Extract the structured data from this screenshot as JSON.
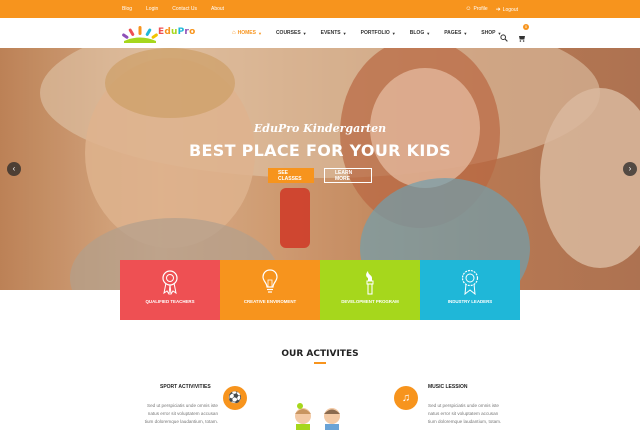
{
  "topbar": {
    "links": [
      "Blog",
      "Login",
      "Contact Us",
      "About"
    ],
    "profile": "Profile",
    "logout": "Logout"
  },
  "logo": {
    "text": "EduPro"
  },
  "nav": {
    "items": [
      "HOMES",
      "COURSES",
      "EVENTS",
      "PORTFOLIO",
      "BLOG",
      "PAGES",
      "SHOP"
    ]
  },
  "cart": {
    "count": "0"
  },
  "hero": {
    "subtitle": "EduPro Kindergarten",
    "title": "BEST PLACE FOR YOUR KIDS",
    "primary_button": "SEE CLASSES",
    "secondary_button": "LEARN MORE"
  },
  "features": [
    {
      "label": "QUALIFIED TEACHERS",
      "color": "#ee5053",
      "icon": "award-ribbon-icon"
    },
    {
      "label": "CREATIVE ENVIROMENT",
      "color": "#f7941d",
      "icon": "lightbulb-icon"
    },
    {
      "label": "DEVELOPMENT PROGRAM",
      "color": "#a6d71c",
      "icon": "paint-brush-icon"
    },
    {
      "label": "INDUSTRY LEADERS",
      "color": "#1fb7d8",
      "icon": "medal-icon"
    }
  ],
  "activities": {
    "title": "OUR ACTIVITES",
    "items": [
      {
        "title": "SPORT ACTIVIVITIES",
        "icon": "football-icon",
        "text": [
          "Sed ut perspiciatis unde omnis iste",
          "natus error sit voluptatem accusan",
          "tium doloremque laudantium, totam."
        ]
      },
      {
        "title": "MUSIC LESSION",
        "icon": "music-note-icon",
        "text": [
          "Sed ut perspiciatis unde omnis iste",
          "natus error sit voluptatem accusan",
          "tium doloremque laudantium, totam."
        ]
      }
    ]
  },
  "colors": {
    "accent": "#f7941d",
    "red": "#ee5053",
    "green": "#a6d71c",
    "blue": "#1fb7d8"
  }
}
